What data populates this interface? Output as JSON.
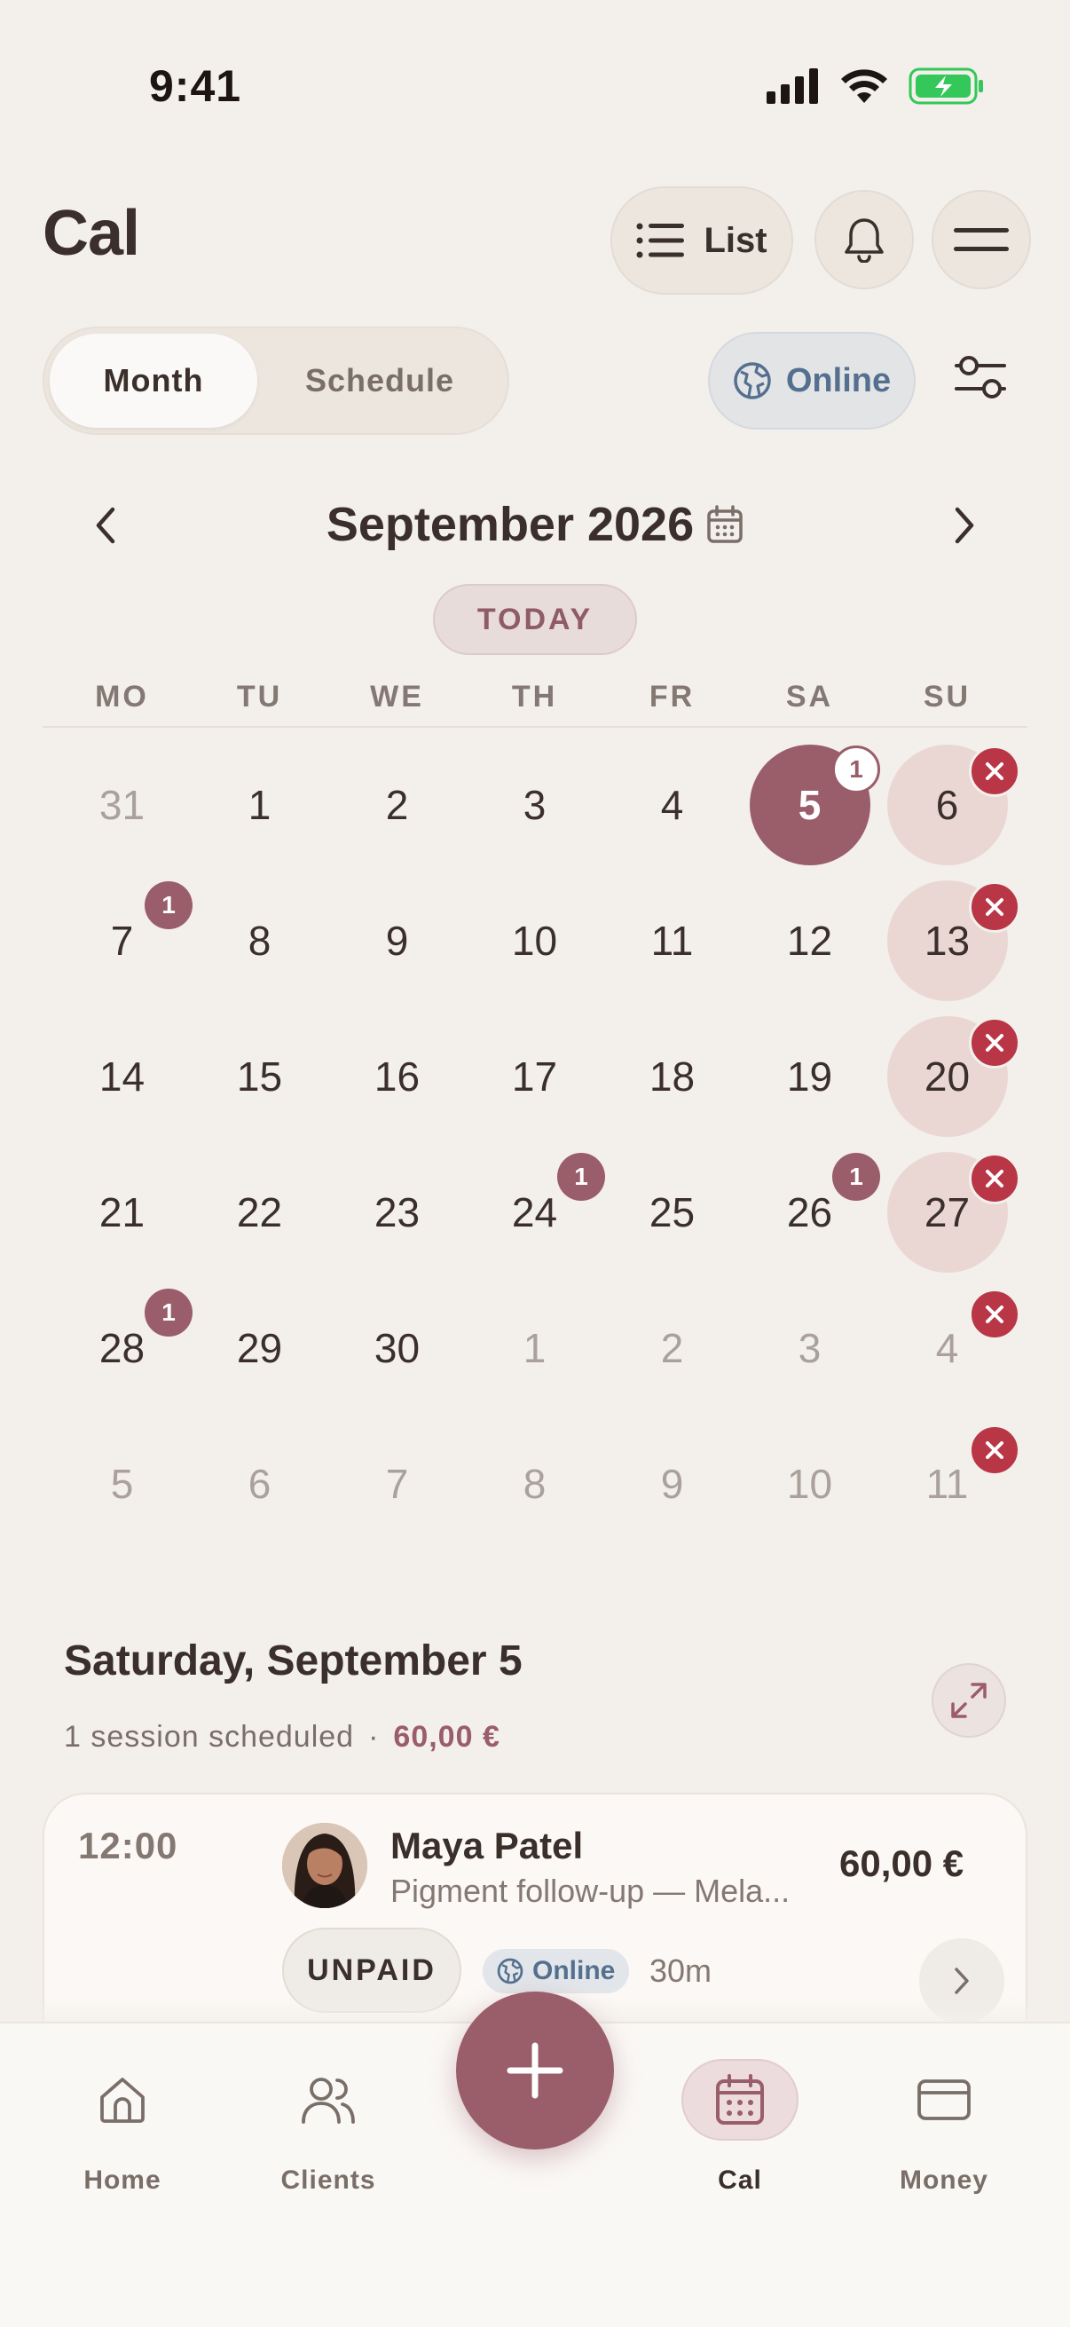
{
  "status_bar": {
    "time": "9:41"
  },
  "header": {
    "title": "Cal",
    "list_label": "List"
  },
  "view_toggle": {
    "month_label": "Month",
    "schedule_label": "Schedule",
    "active": "Month"
  },
  "online_filter": {
    "label": "Online"
  },
  "calendar": {
    "month_label": "September 2026",
    "today_label": "TODAY",
    "weekdays": [
      "MO",
      "TU",
      "WE",
      "TH",
      "FR",
      "SA",
      "SU"
    ],
    "weeks": [
      [
        {
          "d": "31",
          "muted": true
        },
        {
          "d": "1"
        },
        {
          "d": "2"
        },
        {
          "d": "3"
        },
        {
          "d": "4"
        },
        {
          "d": "5",
          "selected": true,
          "count": "1"
        },
        {
          "d": "6",
          "blocked": true
        }
      ],
      [
        {
          "d": "7",
          "count": "1"
        },
        {
          "d": "8"
        },
        {
          "d": "9"
        },
        {
          "d": "10"
        },
        {
          "d": "11"
        },
        {
          "d": "12"
        },
        {
          "d": "13",
          "blocked": true
        }
      ],
      [
        {
          "d": "14"
        },
        {
          "d": "15"
        },
        {
          "d": "16"
        },
        {
          "d": "17"
        },
        {
          "d": "18"
        },
        {
          "d": "19"
        },
        {
          "d": "20",
          "blocked": true
        }
      ],
      [
        {
          "d": "21"
        },
        {
          "d": "22"
        },
        {
          "d": "23"
        },
        {
          "d": "24",
          "count": "1"
        },
        {
          "d": "25"
        },
        {
          "d": "26",
          "count": "1"
        },
        {
          "d": "27",
          "blocked": true
        }
      ],
      [
        {
          "d": "28",
          "count": "1"
        },
        {
          "d": "29"
        },
        {
          "d": "30"
        },
        {
          "d": "1",
          "muted": true
        },
        {
          "d": "2",
          "muted": true
        },
        {
          "d": "3",
          "muted": true
        },
        {
          "d": "4",
          "muted": true,
          "blocked_mark": true
        }
      ],
      [
        {
          "d": "5",
          "muted": true
        },
        {
          "d": "6",
          "muted": true
        },
        {
          "d": "7",
          "muted": true
        },
        {
          "d": "8",
          "muted": true
        },
        {
          "d": "9",
          "muted": true
        },
        {
          "d": "10",
          "muted": true
        },
        {
          "d": "11",
          "muted": true,
          "blocked_mark": true
        }
      ]
    ]
  },
  "day_summary": {
    "title": "Saturday, September 5",
    "sessions_text": "1 session scheduled",
    "separator": "·",
    "total": "60,00 €"
  },
  "session": {
    "time": "12:00",
    "client_name": "Maya Patel",
    "description": "Pigment follow-up — Mela...",
    "price": "60,00 €",
    "payment_status": "UNPAID",
    "mode": "Online",
    "duration": "30m"
  },
  "bottom_nav": {
    "items": [
      {
        "label": "Home"
      },
      {
        "label": "Clients"
      },
      {
        "label": "Cal"
      },
      {
        "label": "Money"
      }
    ],
    "active": "Cal"
  },
  "colors": {
    "accent": "#9a5d6a",
    "background": "#f3efeb",
    "blocked_fill": "#ead7d4",
    "blocked_mark": "#b83646",
    "online_blue": "#55708f"
  }
}
